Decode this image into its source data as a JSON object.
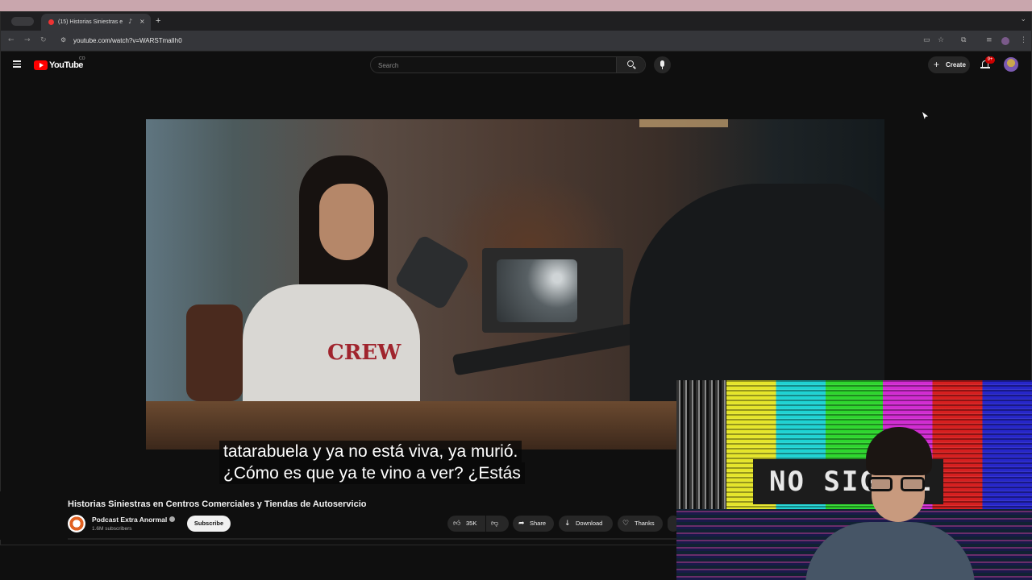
{
  "browser": {
    "tab_title": "(15) Historias Siniestras e",
    "url": "youtube.com/watch?v=WARSTmalIh0",
    "new_tab_glyph": "+",
    "close_glyph": "×"
  },
  "youtube": {
    "logo_text": "YouTube",
    "logo_country": "CO",
    "search_placeholder": "Search",
    "create_label": "Create",
    "notification_count": "9+"
  },
  "video": {
    "subtitle_line1": "tatarabuela y ya no está viva, ya murió.",
    "subtitle_line2": "¿Cómo es que ya te vino a ver? ¿Estás",
    "shirt_print": "CREW"
  },
  "details": {
    "title": "Historias Siniestras en Centros Comerciales y Tiendas de Autoservicio",
    "channel_name": "Podcast Extra Anormal",
    "subscriber_count": "1.6M subscribers",
    "subscribe_label": "Subscribe",
    "likes": "35K",
    "share_label": "Share",
    "download_label": "Download",
    "thanks_label": "Thanks"
  },
  "overlay": {
    "no_signal_text": "NO SIGNAL"
  },
  "icons": [
    "apple-icon",
    "youtube-favicon",
    "audio-icon",
    "close-icon",
    "plus-icon",
    "back-icon",
    "forward-icon",
    "reload-icon",
    "site-info-icon",
    "cast-icon",
    "star-icon",
    "extensions-icon",
    "menu-icon",
    "search-icon",
    "mic-icon",
    "bell-icon",
    "like-icon",
    "dislike-icon",
    "share-icon",
    "download-icon",
    "thanks-icon"
  ],
  "colors": {
    "youtube_red": "#ff0000",
    "background": "#0f0f0f",
    "pill": "#272727"
  }
}
